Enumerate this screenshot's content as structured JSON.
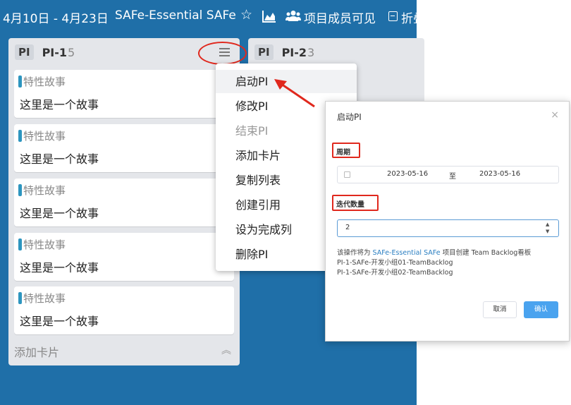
{
  "header": {
    "date_range": "4月10日 - 4月23日",
    "project_name": "SAFe-Essential SAFe",
    "star_icon": "☆",
    "chart_icon": "area-chart-icon",
    "people_icon": "users-icon",
    "visibility_label": "项目成员可见",
    "fold_icon": "fold-icon",
    "fold_label": "折叠"
  },
  "lists": [
    {
      "badge": "PI",
      "title": "PI-1",
      "count": "5",
      "cards": [
        {
          "feature": "特性故事",
          "title": "这里是一个故事"
        },
        {
          "feature": "特性故事",
          "title": "这里是一个故事"
        },
        {
          "feature": "特性故事",
          "title": "这里是一个故事"
        },
        {
          "feature": "特性故事",
          "title": "这里是一个故事"
        },
        {
          "feature": "特性故事",
          "title": "这里是一个故事"
        }
      ],
      "add_card_label": "添加卡片"
    },
    {
      "badge": "PI",
      "title": "PI-2",
      "count": "3"
    }
  ],
  "context_menu": {
    "items": [
      {
        "label": "启动PI",
        "state": "active"
      },
      {
        "label": "修改PI",
        "state": "normal"
      },
      {
        "label": "结束PI",
        "state": "disabled"
      },
      {
        "label": "添加卡片",
        "state": "normal"
      },
      {
        "label": "复制列表",
        "state": "normal"
      },
      {
        "label": "创建引用",
        "state": "normal"
      },
      {
        "label": "设为完成列",
        "state": "normal"
      },
      {
        "label": "删除PI",
        "state": "normal"
      }
    ]
  },
  "dialog": {
    "title": "启动PI",
    "close": "×",
    "period_label": "周期",
    "start_date": "2023-05-16",
    "date_separator": "至",
    "end_date": "2023-05-16",
    "iteration_label": "迭代数量",
    "iteration_value": "2",
    "desc_prefix": "该操作将为",
    "desc_link": "SAFe-Essential SAFe",
    "desc_suffix": "项目创建 Team Backlog看板",
    "backlogs": [
      "PI-1-SAFe-开发小组01-TeamBacklog",
      "PI-1-SAFe-开发小组02-TeamBacklog"
    ],
    "cancel_label": "取消",
    "confirm_label": "确认"
  },
  "colors": {
    "board_bg": "#1f6fa8",
    "highlight_red": "#e0281d",
    "tag_blue": "#2d95bf",
    "confirm_blue": "#4aa3ef"
  }
}
